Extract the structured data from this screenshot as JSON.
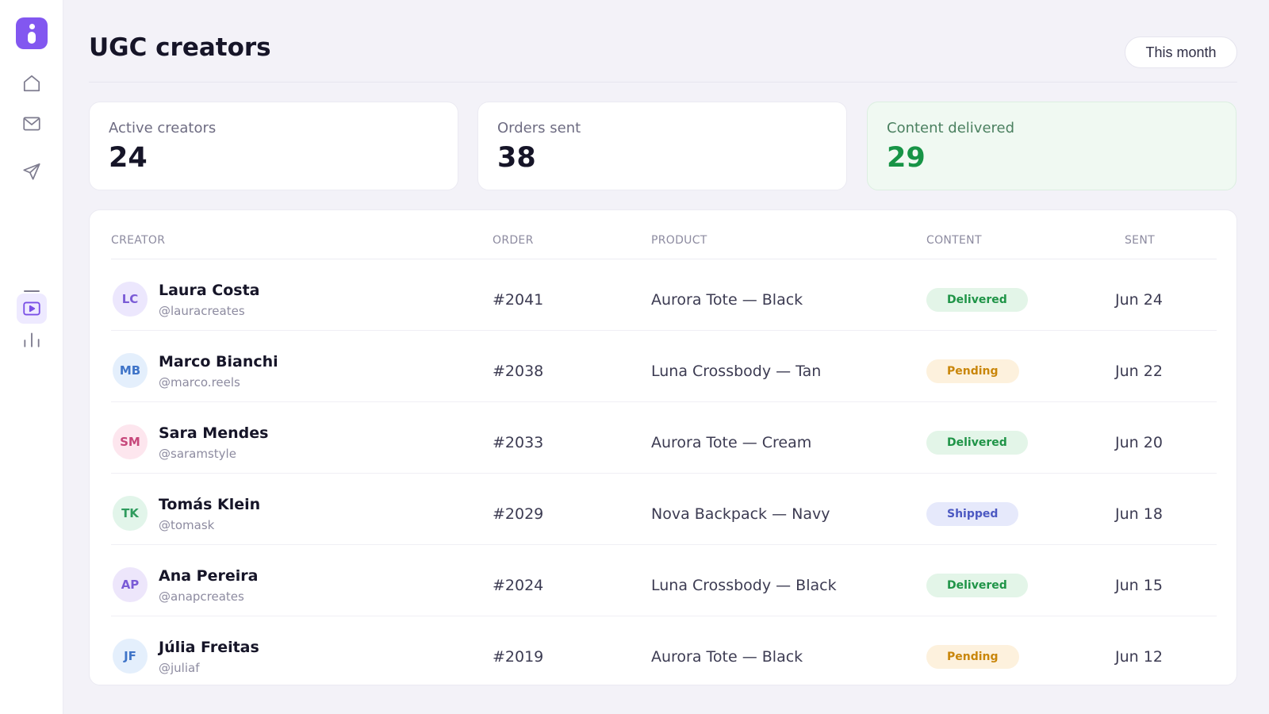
{
  "page": {
    "title": "UGC creators",
    "period": "This month"
  },
  "sidebar": {
    "items": [
      {
        "icon": "home-icon",
        "active": false
      },
      {
        "icon": "mail-icon",
        "active": false
      },
      {
        "icon": "send-icon",
        "active": false
      },
      {
        "icon": "video-icon",
        "active": true
      },
      {
        "icon": "bar-chart-icon",
        "active": false
      }
    ]
  },
  "stats": [
    {
      "label": "Active creators",
      "value": "24"
    },
    {
      "label": "Orders sent",
      "value": "38"
    },
    {
      "label": "Content delivered",
      "value": "29"
    }
  ],
  "table": {
    "headers": {
      "creator": "CREATOR",
      "order": "ORDER",
      "product": "PRODUCT",
      "content": "CONTENT",
      "sent": "SENT"
    },
    "rows": [
      {
        "initials": "LC",
        "name": "Laura Costa",
        "handle": "@lauracreates",
        "order": "#2041",
        "product": "Aurora Tote — Black",
        "status": "Delivered",
        "sent": "Jun 24"
      },
      {
        "initials": "MB",
        "name": "Marco Bianchi",
        "handle": "@marco.reels",
        "order": "#2038",
        "product": "Luna Crossbody — Tan",
        "status": "Pending",
        "sent": "Jun 22"
      },
      {
        "initials": "SM",
        "name": "Sara Mendes",
        "handle": "@saramstyle",
        "order": "#2033",
        "product": "Aurora Tote — Cream",
        "status": "Delivered",
        "sent": "Jun 20"
      },
      {
        "initials": "TK",
        "name": "Tomás Klein",
        "handle": "@tomask",
        "order": "#2029",
        "product": "Nova Backpack — Navy",
        "status": "Shipped",
        "sent": "Jun 18"
      },
      {
        "initials": "AP",
        "name": "Ana Pereira",
        "handle": "@anapcreates",
        "order": "#2024",
        "product": "Luna Crossbody — Black",
        "status": "Delivered",
        "sent": "Jun 15"
      },
      {
        "initials": "JF",
        "name": "Júlia Freitas",
        "handle": "@juliaf",
        "order": "#2019",
        "product": "Aurora Tote — Black",
        "status": "Pending",
        "sent": "Jun 12"
      }
    ]
  },
  "colors": {
    "brand": "#8257f0",
    "delivered": "#1f9447",
    "pending": "#c9860a",
    "shipped": "#4c59c2",
    "avatar_bg": [
      "#ece7fd",
      "#e4effc",
      "#fde6ee",
      "#e2f5ea",
      "#ede6fb",
      "#e4effc"
    ],
    "avatar_fg": [
      "#7a5bd6",
      "#3f74c8",
      "#c6477a",
      "#2e9b5d",
      "#7a5bd6",
      "#3f74c8"
    ]
  }
}
